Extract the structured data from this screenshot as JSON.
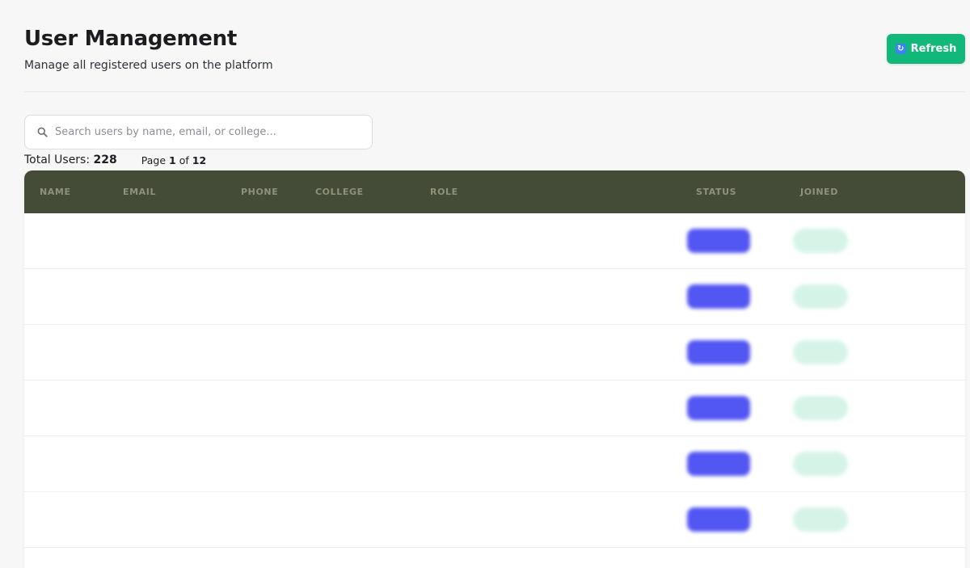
{
  "header": {
    "title": "User Management",
    "subtitle": "Manage all registered users on the platform",
    "refresh_label": "Refresh"
  },
  "search": {
    "placeholder": "Search users by name, email, or college...",
    "value": ""
  },
  "stats": {
    "total_label": "Total Users:",
    "total_value": "228",
    "page_label": "Page",
    "page_current": "1",
    "page_of": "of",
    "page_total": "12"
  },
  "table": {
    "columns": [
      "NAME",
      "EMAIL",
      "PHONE",
      "COLLEGE",
      "ROLE",
      "STATUS",
      "JOINED"
    ],
    "rows": [
      {
        "name": "",
        "email": "",
        "phone": "",
        "college": "",
        "role": "",
        "role_badge": "",
        "status": "",
        "joined": ""
      },
      {
        "name": "",
        "email": "",
        "phone": "",
        "college": "",
        "role": "",
        "role_badge": "",
        "status": "",
        "joined": ""
      },
      {
        "name": "",
        "email": "",
        "phone": "",
        "college": "",
        "role": "",
        "role_badge": "",
        "status": "",
        "joined": ""
      },
      {
        "name": "",
        "email": "",
        "phone": "",
        "college": "",
        "role": "",
        "role_badge": "",
        "status": "",
        "joined": ""
      },
      {
        "name": "",
        "email": "",
        "phone": "",
        "college": "",
        "role": "",
        "role_badge": "",
        "status": "",
        "joined": ""
      },
      {
        "name": "",
        "email": "",
        "phone": "",
        "college": "",
        "role": "",
        "role_badge": "",
        "status": "",
        "joined": ""
      }
    ]
  },
  "colors": {
    "accent": "#12b87a",
    "table_header": "#444b36",
    "role_badge": "#5256f2",
    "status_badge": "#d5f4e7"
  },
  "icons": {
    "search": "search-icon",
    "refresh": "refresh-icon"
  }
}
